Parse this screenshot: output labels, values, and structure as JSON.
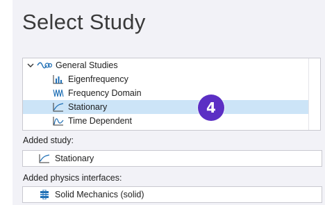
{
  "title": "Select Study",
  "tree": {
    "group": {
      "label": "General Studies",
      "icon": "general-studies-icon"
    },
    "items": [
      {
        "label": "Eigenfrequency",
        "icon": "eigenfrequency-icon"
      },
      {
        "label": "Frequency Domain",
        "icon": "frequency-domain-icon"
      },
      {
        "label": "Stationary",
        "icon": "stationary-icon",
        "selected": true
      },
      {
        "label": "Time Dependent",
        "icon": "time-dependent-icon"
      }
    ]
  },
  "added_study": {
    "label": "Added study:",
    "items": [
      {
        "label": "Stationary",
        "icon": "stationary-icon"
      }
    ]
  },
  "added_physics": {
    "label": "Added physics interfaces:",
    "items": [
      {
        "label": "Solid Mechanics (solid)",
        "icon": "solid-mechanics-icon"
      }
    ]
  },
  "step_badge": {
    "number": "4",
    "color": "#5b2fc4"
  },
  "colors": {
    "selection": "#cce4f7",
    "panel": "#f2f2f7",
    "icon_blue": "#1f6fb5"
  }
}
